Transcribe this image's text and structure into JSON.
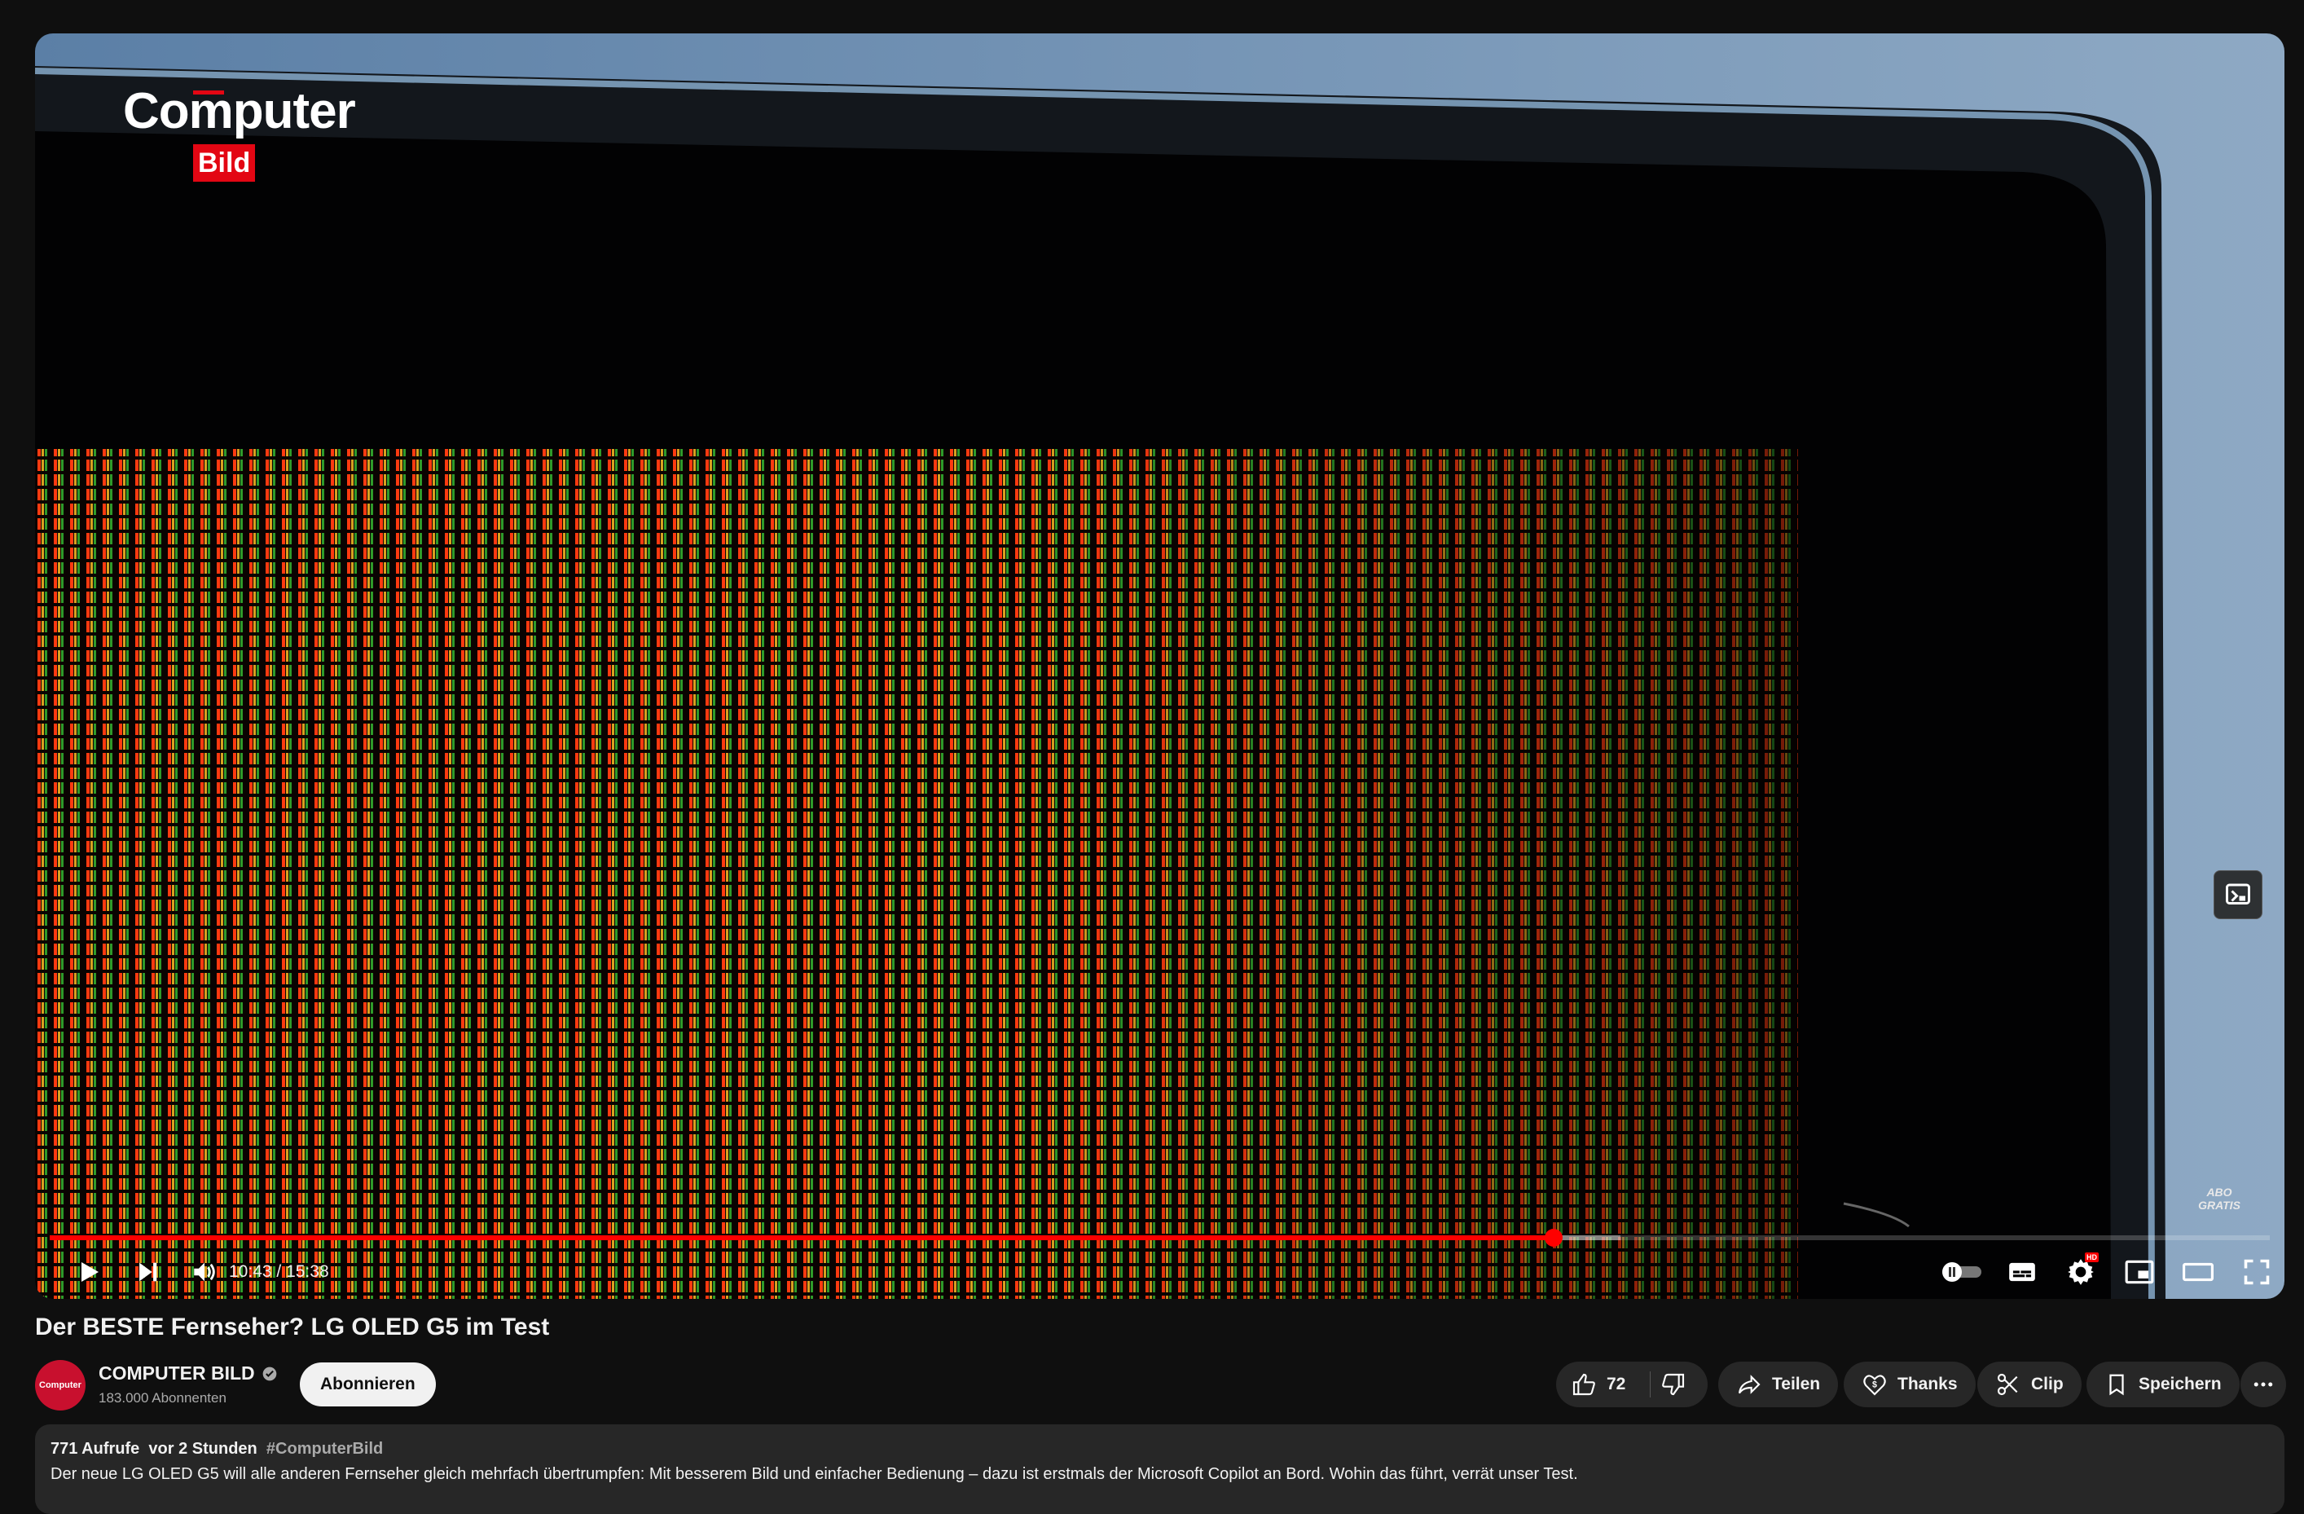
{
  "player": {
    "brand": {
      "line1": "Computer",
      "line2": "Bild"
    },
    "promo_text": "ABO\nGRATIS",
    "progress": {
      "played_fraction": 0.6776,
      "buffered_fraction": 0.7075
    },
    "time": {
      "current": "10:43",
      "separator": " / ",
      "duration": "15:38"
    },
    "controls": {
      "play": "play-icon",
      "next": "next-icon",
      "volume": "volume-icon",
      "autoplay": "autoplay-toggle",
      "subtitles": "subtitles-icon",
      "settings": "gear-icon",
      "settings_badge": "HD",
      "miniplayer": "miniplayer-icon",
      "theater": "theater-icon",
      "fullscreen": "fullscreen-icon"
    }
  },
  "video": {
    "title": "Der BESTE Fernseher? LG OLED G5 im Test"
  },
  "channel": {
    "avatar_text": "Computer",
    "name": "COMPUTER BILD",
    "verified": true,
    "subscribers": "183.000 Abonnenten",
    "subscribe_label": "Abonnieren"
  },
  "actions": {
    "like_count": "72",
    "share_label": "Teilen",
    "thanks_label": "Thanks",
    "clip_label": "Clip",
    "save_label": "Speichern"
  },
  "description": {
    "views": "771 Aufrufe",
    "age": "vor 2 Stunden",
    "hashtag": "#ComputerBild",
    "text": "Der neue LG OLED G5 will alle anderen Fernseher gleich mehrfach übertrumpfen: Mit besserem Bild und einfacher Bedienung – dazu ist erstmals der Microsoft Copilot an Bord. Wohin das führt, verrät unser Test."
  },
  "colors": {
    "accent": "#ff0000",
    "background": "#0f0f0f",
    "surface": "#272727",
    "brand_red": "#e30613"
  }
}
